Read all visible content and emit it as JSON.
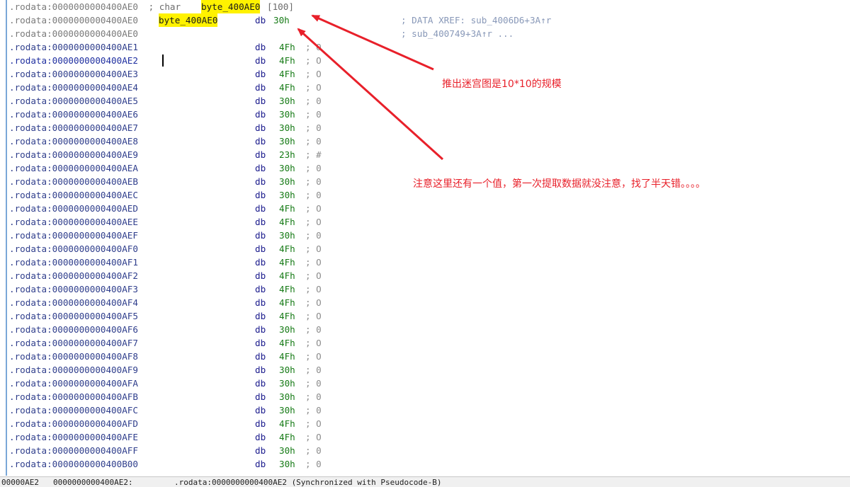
{
  "header": {
    "decl": {
      "addr": ".rodata:0000000000400AE0",
      "prefix": " ; char ",
      "name": "byte_400AE0",
      "suffix": "[100]"
    },
    "def": {
      "addr": ".rodata:0000000000400AE0",
      "label": "byte_400AE0",
      "mnem": "db",
      "val": "30h",
      "xref": "; DATA XREF: sub_4006D6+3A↑r"
    },
    "cont": {
      "addr": ".rodata:0000000000400AE0",
      "xref": "; sub_400749+3A↑r ..."
    }
  },
  "rows": [
    {
      "addr": ".rodata:0000000000400AE1",
      "mnem": "db",
      "val": "4Fh",
      "cmt": "; O"
    },
    {
      "addr": ".rodata:0000000000400AE2",
      "mnem": "db",
      "val": "4Fh",
      "cmt": "; O"
    },
    {
      "addr": ".rodata:0000000000400AE3",
      "mnem": "db",
      "val": "4Fh",
      "cmt": "; O"
    },
    {
      "addr": ".rodata:0000000000400AE4",
      "mnem": "db",
      "val": "4Fh",
      "cmt": "; O"
    },
    {
      "addr": ".rodata:0000000000400AE5",
      "mnem": "db",
      "val": "30h",
      "cmt": "; 0"
    },
    {
      "addr": ".rodata:0000000000400AE6",
      "mnem": "db",
      "val": "30h",
      "cmt": "; 0"
    },
    {
      "addr": ".rodata:0000000000400AE7",
      "mnem": "db",
      "val": "30h",
      "cmt": "; 0"
    },
    {
      "addr": ".rodata:0000000000400AE8",
      "mnem": "db",
      "val": "30h",
      "cmt": "; 0"
    },
    {
      "addr": ".rodata:0000000000400AE9",
      "mnem": "db",
      "val": "23h",
      "cmt": "; #"
    },
    {
      "addr": ".rodata:0000000000400AEA",
      "mnem": "db",
      "val": "30h",
      "cmt": "; 0"
    },
    {
      "addr": ".rodata:0000000000400AEB",
      "mnem": "db",
      "val": "30h",
      "cmt": "; 0"
    },
    {
      "addr": ".rodata:0000000000400AEC",
      "mnem": "db",
      "val": "30h",
      "cmt": "; 0"
    },
    {
      "addr": ".rodata:0000000000400AED",
      "mnem": "db",
      "val": "4Fh",
      "cmt": "; O"
    },
    {
      "addr": ".rodata:0000000000400AEE",
      "mnem": "db",
      "val": "4Fh",
      "cmt": "; O"
    },
    {
      "addr": ".rodata:0000000000400AEF",
      "mnem": "db",
      "val": "30h",
      "cmt": "; 0"
    },
    {
      "addr": ".rodata:0000000000400AF0",
      "mnem": "db",
      "val": "4Fh",
      "cmt": "; O"
    },
    {
      "addr": ".rodata:0000000000400AF1",
      "mnem": "db",
      "val": "4Fh",
      "cmt": "; O"
    },
    {
      "addr": ".rodata:0000000000400AF2",
      "mnem": "db",
      "val": "4Fh",
      "cmt": "; O"
    },
    {
      "addr": ".rodata:0000000000400AF3",
      "mnem": "db",
      "val": "4Fh",
      "cmt": "; O"
    },
    {
      "addr": ".rodata:0000000000400AF4",
      "mnem": "db",
      "val": "4Fh",
      "cmt": "; O"
    },
    {
      "addr": ".rodata:0000000000400AF5",
      "mnem": "db",
      "val": "4Fh",
      "cmt": "; O"
    },
    {
      "addr": ".rodata:0000000000400AF6",
      "mnem": "db",
      "val": "30h",
      "cmt": "; 0"
    },
    {
      "addr": ".rodata:0000000000400AF7",
      "mnem": "db",
      "val": "4Fh",
      "cmt": "; O"
    },
    {
      "addr": ".rodata:0000000000400AF8",
      "mnem": "db",
      "val": "4Fh",
      "cmt": "; O"
    },
    {
      "addr": ".rodata:0000000000400AF9",
      "mnem": "db",
      "val": "30h",
      "cmt": "; 0"
    },
    {
      "addr": ".rodata:0000000000400AFA",
      "mnem": "db",
      "val": "30h",
      "cmt": "; 0"
    },
    {
      "addr": ".rodata:0000000000400AFB",
      "mnem": "db",
      "val": "30h",
      "cmt": "; 0"
    },
    {
      "addr": ".rodata:0000000000400AFC",
      "mnem": "db",
      "val": "30h",
      "cmt": "; 0"
    },
    {
      "addr": ".rodata:0000000000400AFD",
      "mnem": "db",
      "val": "4Fh",
      "cmt": "; O"
    },
    {
      "addr": ".rodata:0000000000400AFE",
      "mnem": "db",
      "val": "4Fh",
      "cmt": "; O"
    },
    {
      "addr": ".rodata:0000000000400AFF",
      "mnem": "db",
      "val": "30h",
      "cmt": "; 0"
    },
    {
      "addr": ".rodata:0000000000400B00",
      "mnem": "db",
      "val": "30h",
      "cmt": "; 0"
    }
  ],
  "annotations": {
    "note_maze": "推出迷宫图是10*10的规模",
    "note_extra": "注意这里还有一个值，第一次提取数据就没注意，找了半天错。。。。"
  },
  "status": {
    "offset": "00000AE2",
    "address": "0000000000400AE2:",
    "location": ".rodata:0000000000400AE2 (Synchronized with Pseudocode-B)"
  },
  "colors": {
    "highlight": "#fff200",
    "annotation": "#e8202a",
    "hex_value": "#157a15",
    "mnemonic": "#1a1a8c"
  }
}
